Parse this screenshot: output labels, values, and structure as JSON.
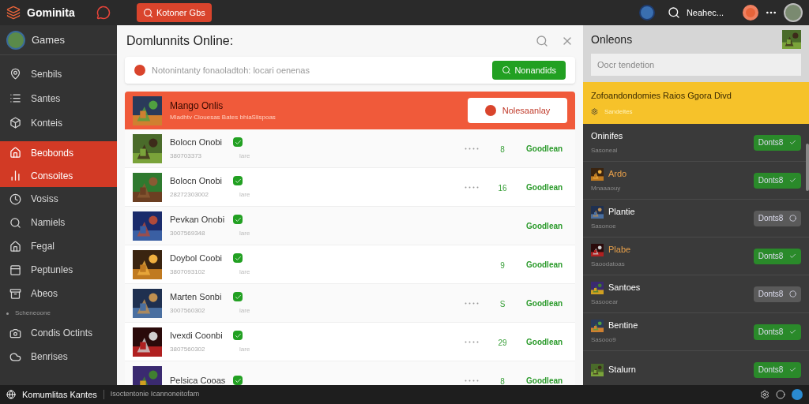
{
  "topbar": {
    "brand": "Gominita",
    "search_button": "Kotoner Gbs",
    "user_name": "Neahec..."
  },
  "sidebar": {
    "profile": "Games",
    "items": [
      {
        "label": "Senbils",
        "selected": false
      },
      {
        "label": "Santes",
        "selected": false
      },
      {
        "label": "Konteis",
        "selected": false
      },
      {
        "label": "Beobonds",
        "selected": true
      },
      {
        "label": "Consoites",
        "selected": true
      },
      {
        "label": "Vosiss",
        "selected": false
      },
      {
        "label": "Namiels",
        "selected": false
      },
      {
        "label": "Fegal",
        "selected": false
      },
      {
        "label": "Peptunles",
        "selected": false
      },
      {
        "label": "Abeos",
        "selected": false
      }
    ],
    "section": "Scheneoone",
    "extra_items": [
      {
        "label": "Condis Octints",
        "selected": false
      },
      {
        "label": "Benrises",
        "selected": false
      }
    ]
  },
  "main": {
    "title": "Domlunnits Online:",
    "notice": "Notonintanty fonaoladtoh: locari oenenas",
    "notice_button": "Nonandids",
    "featured": {
      "name": "Mango Onlis",
      "subtitle": "Mladhtv Ciouesas Bates bhiaSlispoas",
      "button": "Nolesaanlay"
    },
    "rows": [
      {
        "name": "Bolocn Onobi",
        "checked": true,
        "id": "380703373",
        "tag": "lare",
        "dots": true,
        "count": "8",
        "status": "Goodlean"
      },
      {
        "name": "Bolocn Onobi",
        "checked": true,
        "id": "28272303002",
        "tag": "lare",
        "dots": true,
        "count": "16",
        "status": "Goodlean"
      },
      {
        "name": "Pevkan Onobi",
        "checked": true,
        "id": "3007569348",
        "tag": "lare",
        "dots": false,
        "status": "Goodlean"
      },
      {
        "name": "Doybol Coobi",
        "checked": true,
        "id": "3807093102",
        "tag": "lare",
        "dots": false,
        "count": "9",
        "status": "Goodlean"
      },
      {
        "name": "Marten Sonbi",
        "checked": true,
        "id": "3007560302",
        "tag": "lare",
        "dots": true,
        "count": "S",
        "status": "Goodlean"
      },
      {
        "name": "Ivexdi Coonbi",
        "checked": true,
        "id": "3807560302",
        "tag": "lare",
        "dots": true,
        "count": "29",
        "status": "Goodlean"
      },
      {
        "name": "Pelsica Cooas",
        "checked": true,
        "dots": true,
        "count": "8",
        "status": "Goodlean"
      }
    ]
  },
  "right": {
    "title": "Onleons",
    "search": {
      "placeholder": "Oocr tendetion"
    },
    "highlight": {
      "title": "Zofoandondomies Raios Ggora Divd",
      "subtitle": "Sandeltes"
    },
    "items": [
      {
        "name": "Oninifes",
        "sub": "Sasoneal",
        "picture": false,
        "color": "#ffffff",
        "button": "Donts8",
        "on": true
      },
      {
        "name": "Ardo",
        "sub": "Mnaaaouy",
        "picture": true,
        "color": "#e8a04a",
        "button": "Donts8",
        "on": true
      },
      {
        "name": "Plantie",
        "sub": "Sasonoe",
        "picture": true,
        "color": "#ffffff",
        "button": "Donts8",
        "on": false
      },
      {
        "name": "Plabe",
        "sub": "Saoodatoas",
        "picture": true,
        "color": "#e8a04a",
        "button": "Donts8",
        "on": true
      },
      {
        "name": "Santoes",
        "sub": "Sasooear",
        "picture": true,
        "color": "#ffffff",
        "button": "Donts8",
        "on": false
      },
      {
        "name": "Bentine",
        "sub": "Sasooo9",
        "picture": true,
        "color": "#ffffff",
        "button": "Donts8",
        "on": true
      },
      {
        "name": "Stalurn",
        "picture": true,
        "color": "#ffffff",
        "button": "Donts8",
        "on": true
      }
    ]
  },
  "statusbar": {
    "title": "Komumlitas Kantes",
    "text": "Isoctentonie Icannoneitofam"
  }
}
